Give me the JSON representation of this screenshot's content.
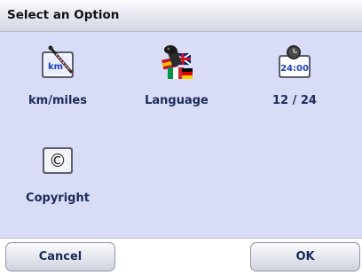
{
  "dialog": {
    "title": "Select an Option"
  },
  "options": [
    {
      "label": "km/miles",
      "icon": "km-miles-icon"
    },
    {
      "label": "Language",
      "icon": "language-flags-icon"
    },
    {
      "label": "12 / 24",
      "icon": "clock-icon",
      "clock_text": "24:00"
    },
    {
      "label": "Copyright",
      "icon": "copyright-icon",
      "symbol": "©"
    }
  ],
  "icon_texts": {
    "km": "km"
  },
  "buttons": {
    "cancel": "Cancel",
    "ok": "OK"
  },
  "colors": {
    "background": "#d8dcf6",
    "label_text": "#1a2a5a",
    "title_bar": "#e2e4ee"
  }
}
